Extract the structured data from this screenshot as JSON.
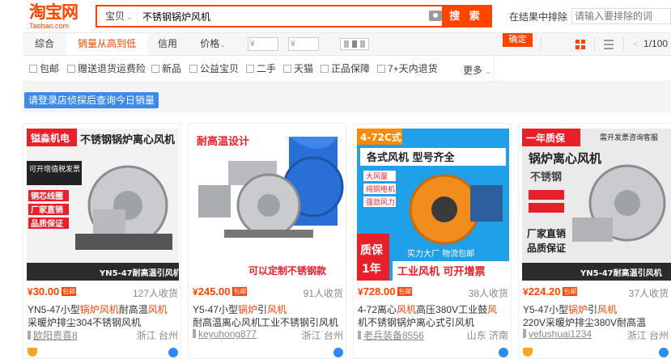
{
  "header": {
    "logo_cn": "淘宝网",
    "logo_en": "Taobao.com",
    "search_type": "宝贝",
    "search_query": "不锈钢锅炉风机",
    "search_button": "搜 索",
    "exclude_label": "在结果中排除",
    "exclude_placeholder": "请输入要排除的词",
    "confirm_button": "确定"
  },
  "sort": {
    "tabs": [
      "综合",
      "销量从高到低",
      "信用",
      "价格"
    ],
    "price_min": "¥",
    "price_max": "¥",
    "price_dash": "-",
    "page": "1/100",
    "prev": "<"
  },
  "filters": {
    "items": [
      "包邮",
      "赠送退货运费险",
      "新品",
      "公益宝贝",
      "二手",
      "天猫",
      "正品保障",
      "7+天内退货"
    ],
    "more": "更多"
  },
  "login_tip": "请登录店侦探后查询今日销量",
  "products": [
    {
      "price": "30.00",
      "currency": "¥",
      "free_ship": "包邮",
      "sold": "127人收货",
      "title_pre": "YN5-47小型",
      "title_em1": "锅炉风机",
      "title_mid": "耐高温",
      "title_em2": "风机",
      "title_line2": "采暖炉排尘304不锈钢风机",
      "shop": "欧阳贵喜8",
      "location": "浙江 台州",
      "img_tag": "镒淼机电",
      "img_headline": "不锈钢锅炉离心风机",
      "img_lines": [
        "可开增值税发票",
        "铜芯线圈",
        "厂家直销",
        "品质保证"
      ],
      "img_model": "YN5-47耐高温引风机"
    },
    {
      "price": "245.00",
      "currency": "¥",
      "free_ship": "包邮",
      "sold": "91人收货",
      "title_pre": "Y5-47小型",
      "title_em1": "锅炉",
      "title_mid": "引",
      "title_em2": "风机",
      "title_line2": "耐高温离心风机工业不锈钢引风机",
      "shop": "keyuhong877",
      "location": "浙江 台州",
      "img_tag": "耐高温设计",
      "img_headline": "",
      "img_lines": [],
      "img_model": "可以定制不锈钢款"
    },
    {
      "price": "728.00",
      "currency": "¥",
      "free_ship": "包邮",
      "sold": "38人收货",
      "title_pre": "4-72离心",
      "title_em1": "风机",
      "title_mid": "高压380V工业鼓",
      "title_em2": "风",
      "title_line2": "机不锈钢锅炉离心式引风机",
      "shop": "老兵装备8556",
      "location": "山东 济南",
      "img_tag": "4-72C式",
      "img_headline": "各式风机 型号齐全",
      "img_lines": [
        "大风量",
        "纯铜电机",
        "强劲风力",
        "实力大厂 物流包邮"
      ],
      "img_model": "工业风机 可开增票"
    },
    {
      "price": "224.20",
      "currency": "¥",
      "free_ship": "包邮",
      "sold": "37人收货",
      "title_pre": "Y5-47小型",
      "title_em1": "锅炉",
      "title_mid": "引",
      "title_em2": "风机",
      "title_line2": "220V采暖炉排尘380V耐高温",
      "shop": "yefushuai1234",
      "location": "浙江 台州",
      "img_tag": "一年质保",
      "img_headline": "锅炉离心风机",
      "img_lines": [
        "需开发票咨询客服",
        "不锈钢",
        "厂家直销",
        "品质保证"
      ],
      "img_model": "YN5-47耐高温引风机"
    }
  ],
  "colors": {
    "accent": "#ff4400",
    "login_blue": "#3d8ae8"
  }
}
